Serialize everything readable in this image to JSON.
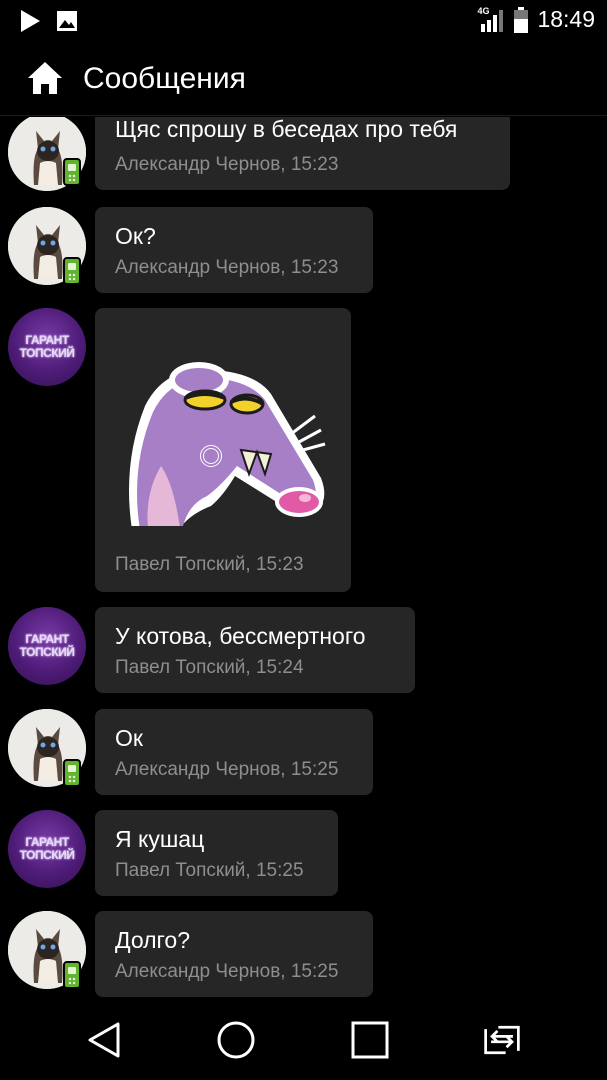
{
  "status_bar": {
    "time": "18:49",
    "network": "4G",
    "icons": [
      "play-icon",
      "image-icon",
      "signal-icon",
      "battery-icon"
    ]
  },
  "header": {
    "title": "Сообщения",
    "icon": "home-icon"
  },
  "messages": [
    {
      "text": "Щяс спрошу в беседах про тебя",
      "author": "Александр Чернов",
      "time": "15:23",
      "meta": "Александр Чернов, 15:23",
      "avatar": "cat"
    },
    {
      "text": "Ок?",
      "author": "Александр Чернов",
      "time": "15:23",
      "meta": "Александр Чернов, 15:23",
      "avatar": "cat"
    },
    {
      "text": "",
      "author": "Павел Топский",
      "time": "15:23",
      "meta": "Павел Топский, 15:23",
      "avatar": "group",
      "sticker": "rat-sticker"
    },
    {
      "text": "У котова, бессмертного",
      "author": "Павел Топский",
      "time": "15:24",
      "meta": "Павел Топский, 15:24",
      "avatar": "group"
    },
    {
      "text": "Ок",
      "author": "Александр Чернов",
      "time": "15:25",
      "meta": "Александр Чернов, 15:25",
      "avatar": "cat"
    },
    {
      "text": "Я кушац",
      "author": "Павел Топский",
      "time": "15:25",
      "meta": "Павел Топский, 15:25",
      "avatar": "group"
    },
    {
      "text": "Долго?",
      "author": "Александр Чернов",
      "time": "15:25",
      "meta": "Александр Чернов, 15:25",
      "avatar": "cat"
    }
  ],
  "group_avatar_text": {
    "line1": "ГАРАНТ",
    "line2": "ТОПСКИЙ"
  },
  "nav_bar": {
    "buttons": [
      "back-icon",
      "home-circle-icon",
      "recents-icon",
      "switch-icon"
    ]
  },
  "colors": {
    "background": "#000000",
    "bubble": "#262626",
    "meta_text": "#8e8e8e",
    "group_avatar": "#5a2388",
    "phone_badge": "#62b32e"
  }
}
